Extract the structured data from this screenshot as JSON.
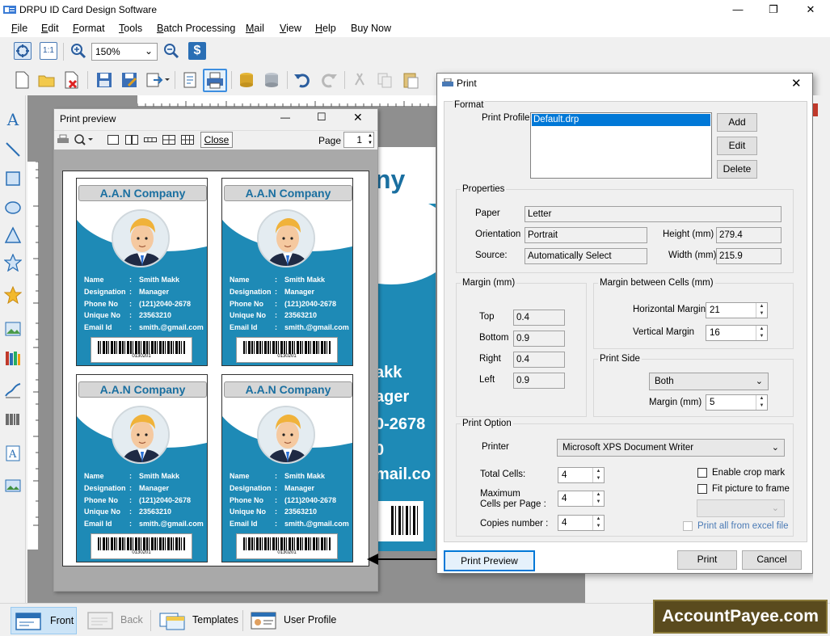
{
  "app": {
    "title": "DRPU ID Card Design Software"
  },
  "menu": [
    {
      "key": "F",
      "rest": "ile"
    },
    {
      "key": "E",
      "rest": "dit"
    },
    {
      "key": "F",
      "rest": "ormat"
    },
    {
      "key": "T",
      "rest": "ools"
    },
    {
      "key": "B",
      "rest": "atch Processing"
    },
    {
      "key": "M",
      "rest": "ail"
    },
    {
      "key": "V",
      "rest": "iew"
    },
    {
      "key": "H",
      "rest": "elp"
    },
    {
      "key": "",
      "rest": "Buy Now"
    }
  ],
  "toolbar": {
    "zoom": "150%",
    "fit_label": "1:1"
  },
  "preview": {
    "title": "Print preview",
    "close_label": "Close",
    "page_label": "Page",
    "page_value": "1"
  },
  "card": {
    "company": "A.A.N Company",
    "fields": [
      {
        "label": "Name",
        "value": "Smith Makk"
      },
      {
        "label": "Designation",
        "value": "Manager"
      },
      {
        "label": "Phone No",
        "value": "(121)2040-2678"
      },
      {
        "label": "Unique No",
        "value": "23563210"
      },
      {
        "label": "Email Id",
        "value": "smith.@gmail.com"
      }
    ],
    "barcode": "0130201"
  },
  "background_card": {
    "company_fragment": "ny",
    "name_fragment": "akk",
    "designation_fragment": "ager",
    "phone_fragment": "0-2678",
    "unique_fragment": "0",
    "email_fragment": "mail.co"
  },
  "print": {
    "title": "Print",
    "format": {
      "group": "Format",
      "profile_label": "Print Profile",
      "profile_selected": "Default.drp",
      "add": "Add",
      "edit": "Edit",
      "delete": "Delete"
    },
    "properties": {
      "group": "Properties",
      "paper_label": "Paper",
      "paper": "Letter",
      "orientation_label": "Orientation",
      "orientation": "Portrait",
      "height_label": "Height (mm)",
      "height": "279.4",
      "source_label": "Source:",
      "source": "Automatically Select",
      "width_label": "Width (mm)",
      "width": "215.9"
    },
    "margin": {
      "group": "Margin (mm)",
      "top_label": "Top",
      "top": "0.4",
      "bottom_label": "Bottom",
      "bottom": "0.9",
      "right_label": "Right",
      "right": "0.4",
      "left_label": "Left",
      "left": "0.9"
    },
    "cell_margin": {
      "group": "Margin between Cells (mm)",
      "h_label": "Horizontal Margin",
      "h": "21",
      "v_label": "Vertical Margin",
      "v": "16"
    },
    "side": {
      "group": "Print Side",
      "value": "Both",
      "margin_label": "Margin (mm)",
      "margin": "5"
    },
    "option": {
      "group": "Print Option",
      "printer_label": "Printer",
      "printer": "Microsoft XPS Document Writer",
      "total_label": "Total Cells:",
      "total": "4",
      "max_label_1": "Maximum",
      "max_label_2": "Cells per Page :",
      "max": "4",
      "copies_label": "Copies number :",
      "copies": "4",
      "crop": "Enable crop mark",
      "fit": "Fit picture to frame",
      "excel": "Print all from excel file"
    },
    "preview_btn": "Print Preview",
    "print_btn": "Print",
    "cancel_btn": "Cancel"
  },
  "bottom": {
    "tabs": [
      {
        "label": "Front"
      },
      {
        "label": "Back"
      },
      {
        "label": "Templates"
      },
      {
        "label": "User Profile"
      }
    ]
  },
  "watermark": "AccountPayee.com",
  "colors": {
    "card_blue": "#1e8ab6",
    "company_text": "#1a6fa0",
    "accent": "#0078d7"
  }
}
